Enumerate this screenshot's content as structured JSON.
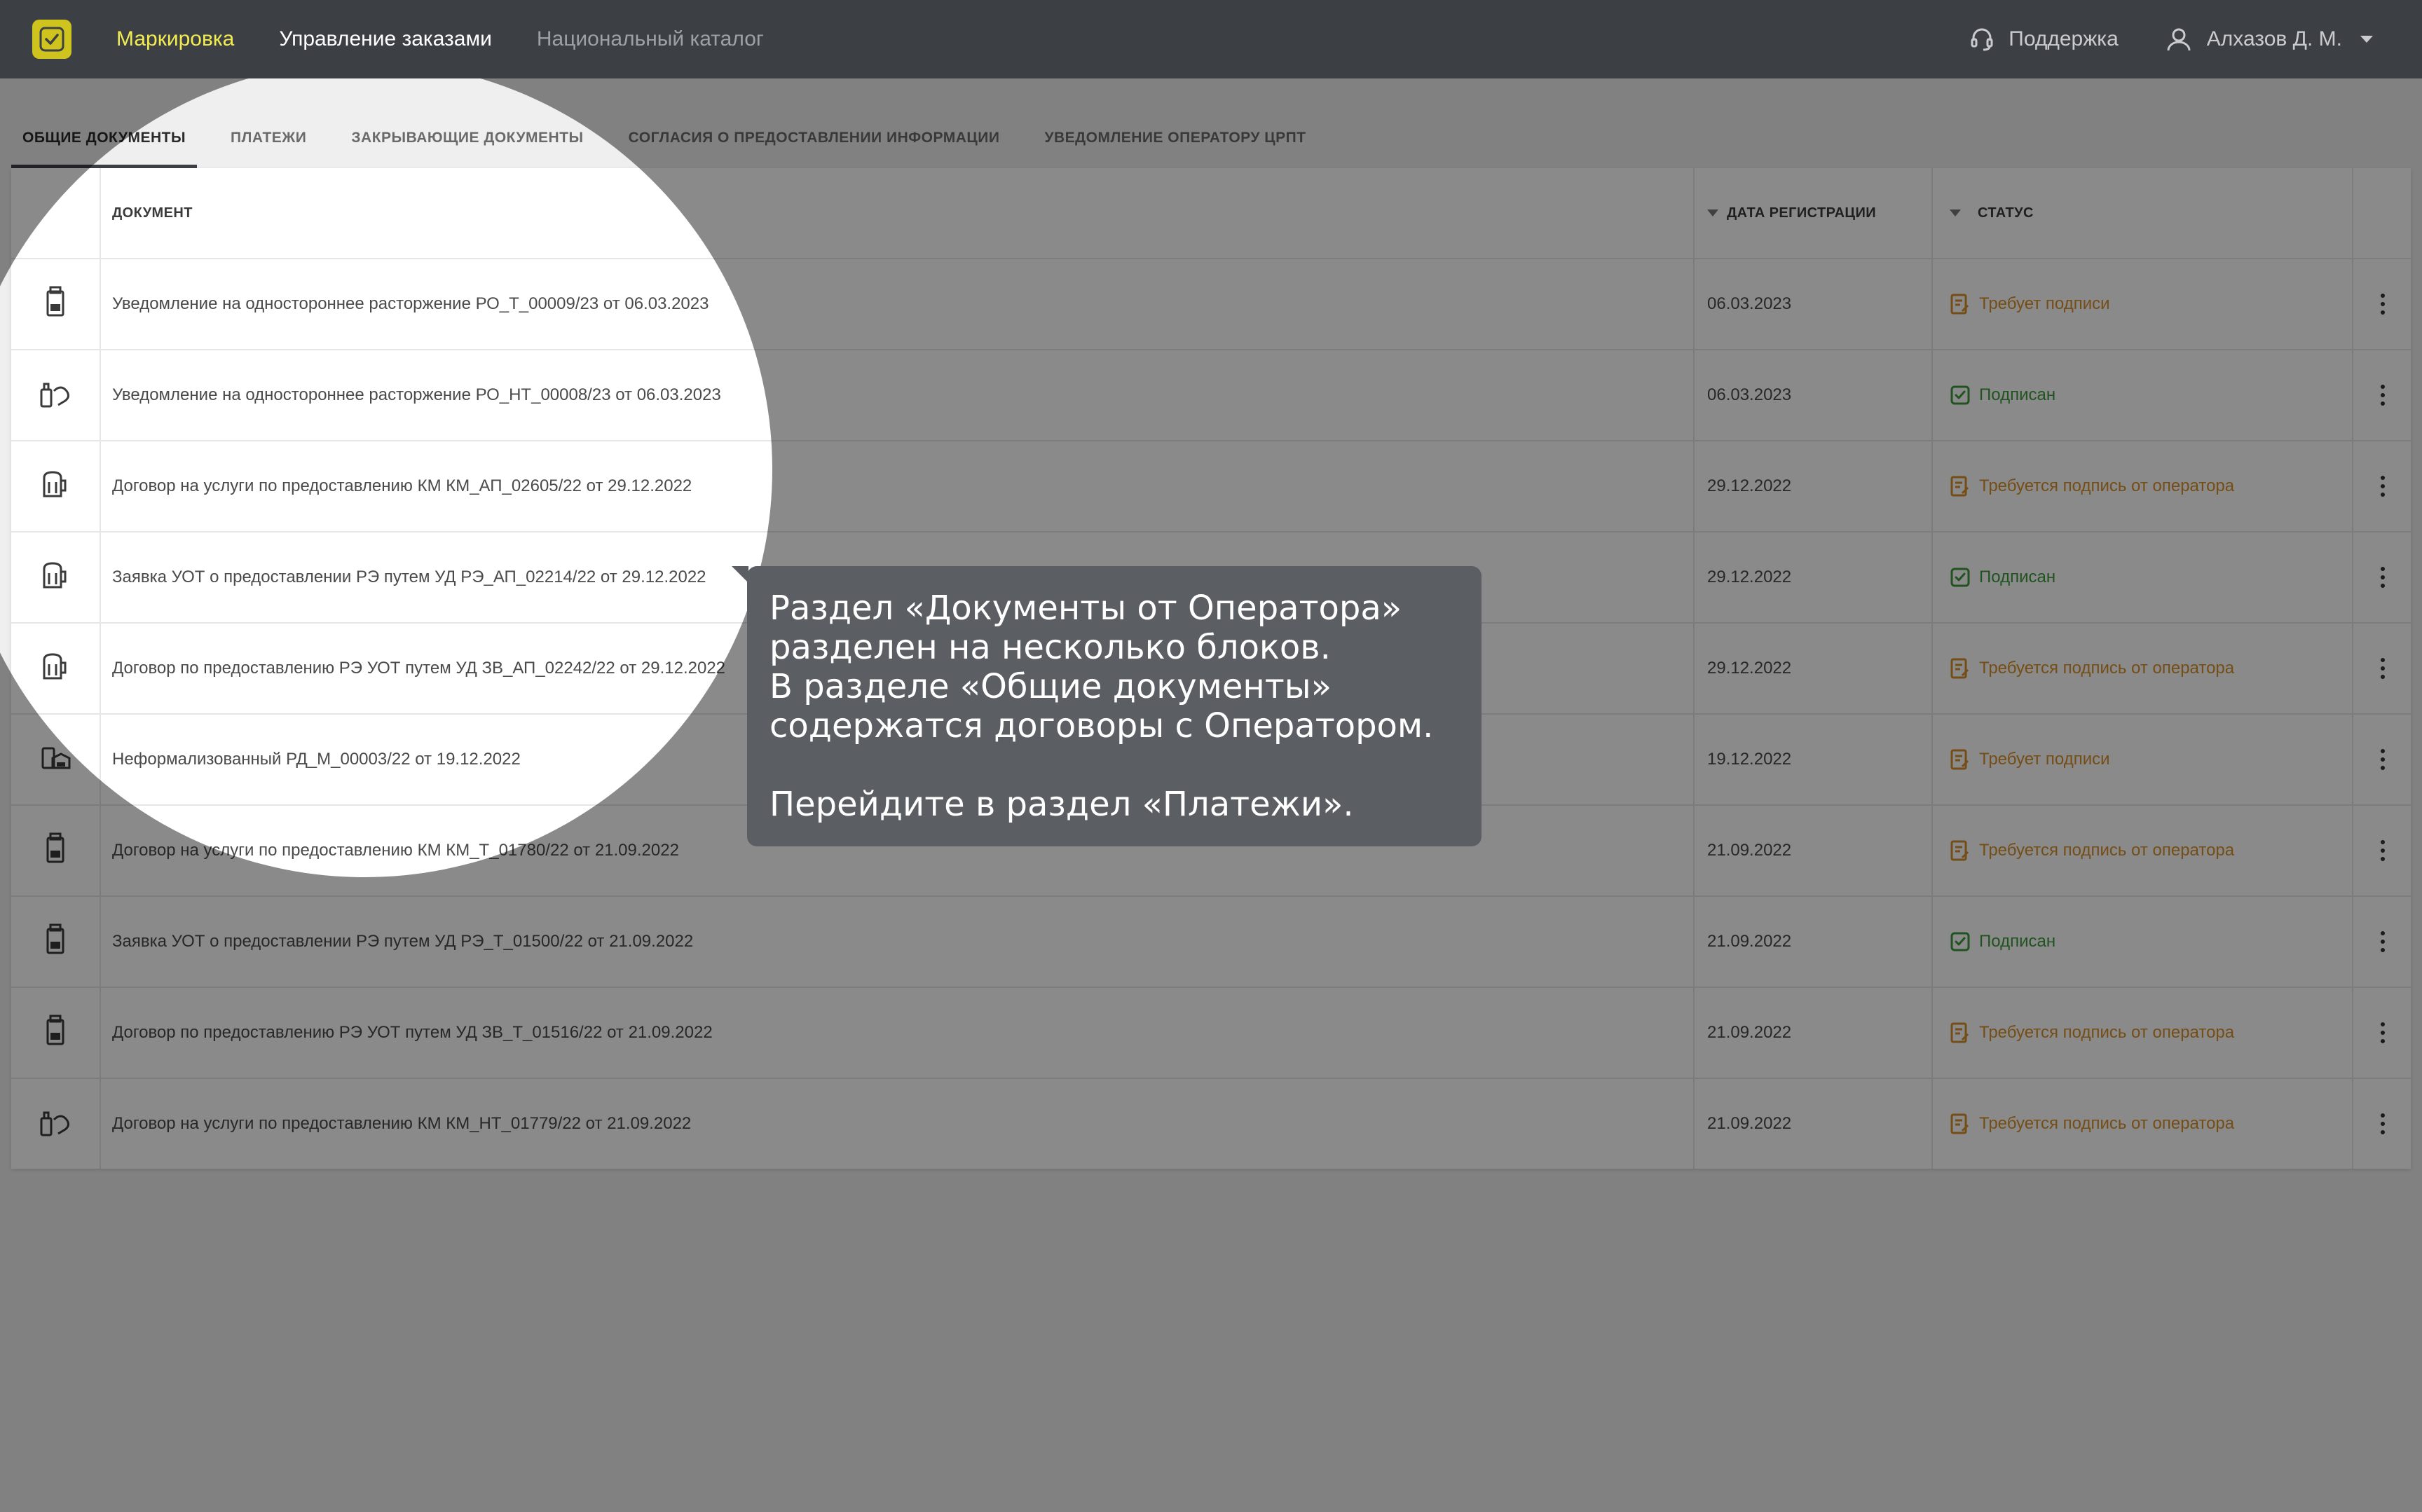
{
  "nav": {
    "items": [
      {
        "label": "Маркировка",
        "state": "active"
      },
      {
        "label": "Управление заказами",
        "state": "current"
      },
      {
        "label": "Национальный каталог",
        "state": "muted"
      }
    ],
    "support_label": "Поддержка",
    "user_name": "Алхазов Д. М."
  },
  "tabs": [
    {
      "label": "ОБЩИЕ ДОКУМЕНТЫ",
      "active": true
    },
    {
      "label": "ПЛАТЕЖИ",
      "active": false
    },
    {
      "label": "ЗАКРЫВАЮЩИЕ ДОКУМЕНТЫ",
      "active": false
    },
    {
      "label": "СОГЛАСИЯ О ПРЕДОСТАВЛЕНИИ ИНФОРМАЦИИ",
      "active": false
    },
    {
      "label": "УВЕДОМЛЕНИЕ ОПЕРАТОРУ ЦРПТ",
      "active": false
    }
  ],
  "table": {
    "headers": {
      "document": "ДОКУМЕНТ",
      "date": "ДАТА РЕГИСТРАЦИИ",
      "status": "СТАТУС"
    },
    "rows": [
      {
        "icon": "tobacco-pack-icon",
        "document": "Уведомление на одностороннее расторжение РО_Т_00009/23 от 06.03.2023",
        "date": "06.03.2023",
        "status": "Требует подписи",
        "kind": "warn"
      },
      {
        "icon": "nicotine-products-icon",
        "document": "Уведомление на одностороннее расторжение РО_НТ_00008/23 от 06.03.2023",
        "date": "06.03.2023",
        "status": "Подписан",
        "kind": "ok"
      },
      {
        "icon": "beer-mug-icon",
        "document": "Договор на услуги по предоставлению КМ КМ_АП_02605/22 от 29.12.2022",
        "date": "29.12.2022",
        "status": "Требуется подпись от оператора",
        "kind": "warn"
      },
      {
        "icon": "beer-mug-icon",
        "document": "Заявка УОТ о предоставлении РЭ путем УД РЭ_АП_02214/22 от 29.12.2022",
        "date": "29.12.2022",
        "status": "Подписан",
        "kind": "ok"
      },
      {
        "icon": "beer-mug-icon",
        "document": "Договор по предоставлению РЭ УОТ путем УД ЗВ_АП_02242/22 от 29.12.2022",
        "date": "29.12.2022",
        "status": "Требуется подпись от оператора",
        "kind": "warn"
      },
      {
        "icon": "mixed-goods-icon",
        "document": "Неформализованный РД_М_00003/22 от 19.12.2022",
        "date": "19.12.2022",
        "status": "Требует подписи",
        "kind": "warn"
      },
      {
        "icon": "tobacco-pack-icon",
        "document": "Договор на услуги по предоставлению КМ КМ_Т_01780/22 от 21.09.2022",
        "date": "21.09.2022",
        "status": "Требуется подпись от оператора",
        "kind": "warn"
      },
      {
        "icon": "tobacco-pack-icon",
        "document": "Заявка УОТ о предоставлении РЭ путем УД РЭ_Т_01500/22 от 21.09.2022",
        "date": "21.09.2022",
        "status": "Подписан",
        "kind": "ok"
      },
      {
        "icon": "tobacco-pack-icon",
        "document": "Договор по предоставлению РЭ УОТ путем УД ЗВ_Т_01516/22 от 21.09.2022",
        "date": "21.09.2022",
        "status": "Требуется подпись от оператора",
        "kind": "warn"
      },
      {
        "icon": "nicotine-products-icon",
        "document": "Договор на услуги по предоставлению КМ КМ_НТ_01779/22 от 21.09.2022",
        "date": "21.09.2022",
        "status": "Требуется подпись от оператора",
        "kind": "warn"
      }
    ]
  },
  "tooltip": {
    "lines": [
      "Раздел «Документы от Оператора»",
      "разделен на несколько блоков.",
      "В разделе «Общие документы»",
      "содержатся договоры с Оператором."
    ],
    "cta": "Перейдите в раздел «Платежи»."
  },
  "colors": {
    "topbar": "#3c3f44",
    "accent": "#f2ec4f",
    "status_warn": "#d6902a",
    "status_ok": "#3c9a3a",
    "tooltip": "#5b5e62"
  }
}
